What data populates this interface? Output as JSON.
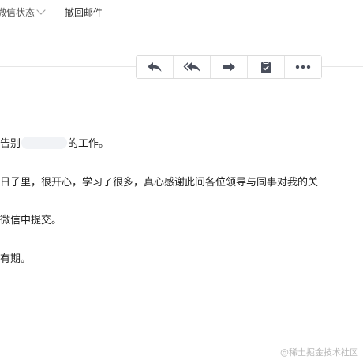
{
  "topbar": {
    "wechat_status": "微信状态",
    "recall_link": "撤回邮件"
  },
  "toolbar": {
    "buttons": [
      {
        "icon": "reply-icon"
      },
      {
        "icon": "reply-all-icon"
      },
      {
        "icon": "forward-icon"
      },
      {
        "icon": "clipboard-icon"
      },
      {
        "icon": "more-icon"
      }
    ],
    "icon_color": "#4a4f5c"
  },
  "body": {
    "line1_prefix": "告别",
    "line1_suffix": "的工作。",
    "line2": "日子里，很开心，学习了很多，真心感谢此间各位领导与同事对我的关",
    "line3": "微信中提交。",
    "line4": "有期。"
  },
  "watermark": "@稀土掘金技术社区"
}
